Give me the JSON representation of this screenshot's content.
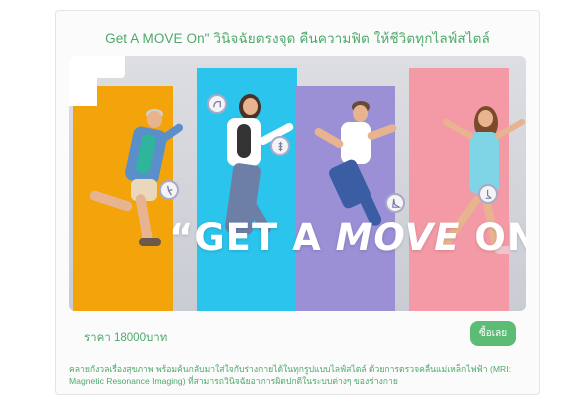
{
  "headline": "Get A MOVE On\" วินิจฉัยตรงจุด คืนความฟิต ให้ชีวิตทุกไลฟ์สไตล์",
  "banner": {
    "slogan_part1": "“GET A ",
    "slogan_move": "MOVE",
    "slogan_part2": " ON”",
    "colors": {
      "panel1": "#f2a40a",
      "panel2": "#2bc4ec",
      "panel3": "#9b8fd6",
      "panel4": "#f39aa6"
    }
  },
  "price": "ราคา 18000บาท",
  "buy_button": "ซื้อเลย",
  "description": "คลายกังวลเรื่องสุขภาพ พร้อมค้นกลับมาใส่ใจกับร่างกายได้ในทุกรูปแบบไลฟ์สไตล์ ด้วยการตรวจคลื่นแม่เหล็กไฟฟ้า (MRI: Magnetic Resonance Imaging) ที่สามารถวินิจฉัยอาการผิดปกติในระบบต่างๆ ของร่างกาย",
  "icons": [
    "knee-icon",
    "shoulder-icon",
    "spine-icon",
    "foot-icon",
    "ankle-icon"
  ],
  "accent_color": "#4ea86a"
}
